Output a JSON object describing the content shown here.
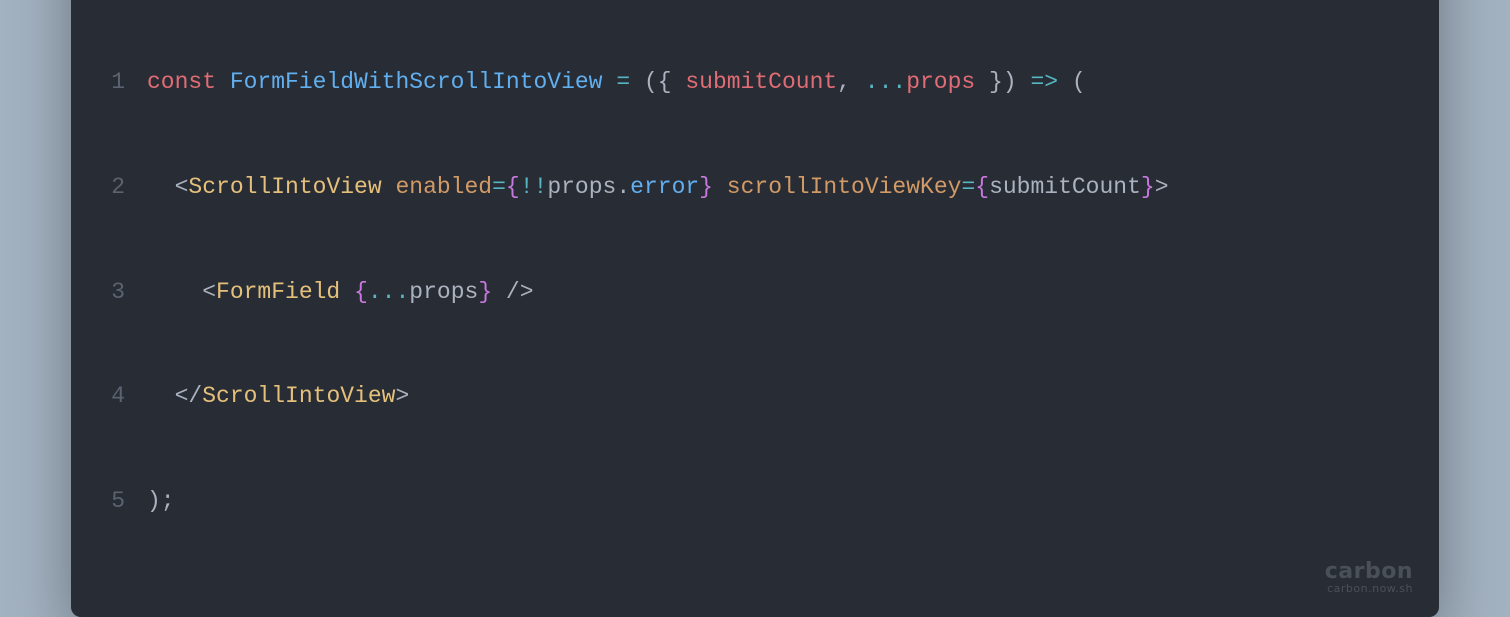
{
  "colors": {
    "background": "#a3b2c1",
    "window": "#282c34",
    "red": "#ff5f56",
    "yellow": "#ffbd2e",
    "green": "#27c93f",
    "gutter": "#5c6370",
    "default": "#abb2bf",
    "keyword": "#e06c75",
    "function": "#61afef",
    "operator": "#56b6c2",
    "tag": "#e5c07b",
    "attr": "#d19a66",
    "brace": "#c678dd"
  },
  "watermark": {
    "brand": "carbon",
    "url": "carbon.now.sh"
  },
  "lines": [
    {
      "num": "1",
      "tokens": [
        {
          "cls": "kw",
          "t": "const"
        },
        {
          "cls": "def",
          "t": " "
        },
        {
          "cls": "fn",
          "t": "FormFieldWithScrollIntoView"
        },
        {
          "cls": "def",
          "t": " "
        },
        {
          "cls": "op",
          "t": "="
        },
        {
          "cls": "def",
          "t": " ({ "
        },
        {
          "cls": "param",
          "t": "submitCount"
        },
        {
          "cls": "def",
          "t": ", "
        },
        {
          "cls": "op",
          "t": "..."
        },
        {
          "cls": "param",
          "t": "props"
        },
        {
          "cls": "def",
          "t": " }) "
        },
        {
          "cls": "op",
          "t": "=>"
        },
        {
          "cls": "def",
          "t": " ("
        }
      ]
    },
    {
      "num": "2",
      "tokens": [
        {
          "cls": "def",
          "t": "  <"
        },
        {
          "cls": "tag",
          "t": "ScrollIntoView"
        },
        {
          "cls": "def",
          "t": " "
        },
        {
          "cls": "attr",
          "t": "enabled"
        },
        {
          "cls": "op",
          "t": "="
        },
        {
          "cls": "brace",
          "t": "{"
        },
        {
          "cls": "op",
          "t": "!!"
        },
        {
          "cls": "def",
          "t": "props"
        },
        {
          "cls": "def",
          "t": "."
        },
        {
          "cls": "fn",
          "t": "error"
        },
        {
          "cls": "brace",
          "t": "}"
        },
        {
          "cls": "def",
          "t": " "
        },
        {
          "cls": "attr",
          "t": "scrollIntoViewKey"
        },
        {
          "cls": "op",
          "t": "="
        },
        {
          "cls": "brace",
          "t": "{"
        },
        {
          "cls": "def",
          "t": "submitCount"
        },
        {
          "cls": "brace",
          "t": "}"
        },
        {
          "cls": "def",
          "t": ">"
        }
      ]
    },
    {
      "num": "3",
      "tokens": [
        {
          "cls": "def",
          "t": "    <"
        },
        {
          "cls": "tag",
          "t": "FormField"
        },
        {
          "cls": "def",
          "t": " "
        },
        {
          "cls": "brace",
          "t": "{"
        },
        {
          "cls": "op",
          "t": "..."
        },
        {
          "cls": "def",
          "t": "props"
        },
        {
          "cls": "brace",
          "t": "}"
        },
        {
          "cls": "def",
          "t": " />"
        }
      ]
    },
    {
      "num": "4",
      "tokens": [
        {
          "cls": "def",
          "t": "  </"
        },
        {
          "cls": "tag",
          "t": "ScrollIntoView"
        },
        {
          "cls": "def",
          "t": ">"
        }
      ]
    },
    {
      "num": "5",
      "tokens": [
        {
          "cls": "def",
          "t": ");"
        }
      ]
    }
  ]
}
